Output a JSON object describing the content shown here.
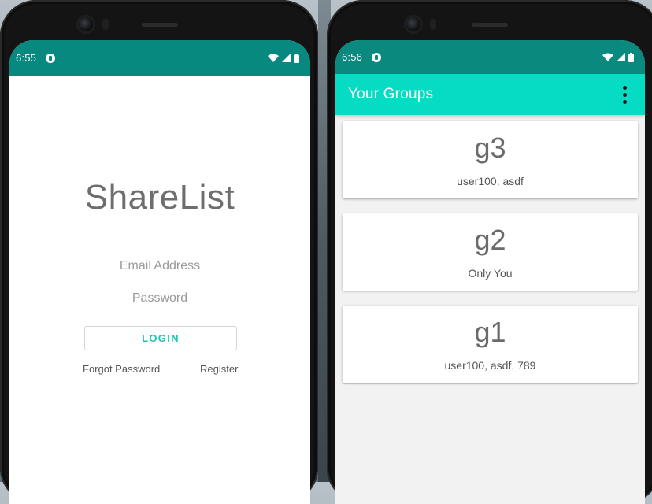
{
  "login_screen": {
    "status": {
      "time": "6:55"
    },
    "app_title": "ShareList",
    "email_placeholder": "Email Address",
    "password_placeholder": "Password",
    "login_label": "LOGIN",
    "forgot_password_label": "Forgot Password",
    "register_label": "Register"
  },
  "groups_screen": {
    "status": {
      "time": "6:56"
    },
    "title": "Your Groups",
    "groups": [
      {
        "name": "g3",
        "members": "user100, asdf"
      },
      {
        "name": "g2",
        "members": "Only You"
      },
      {
        "name": "g1",
        "members": "user100, asdf, 789"
      }
    ]
  },
  "colors": {
    "status_bar": "#07897F",
    "toolbar": "#06DCC3",
    "accent_text": "#19C7B3"
  },
  "icons": [
    "wifi-icon",
    "cell-signal-icon",
    "battery-icon",
    "more-vert-icon",
    "app-notification-icon"
  ]
}
